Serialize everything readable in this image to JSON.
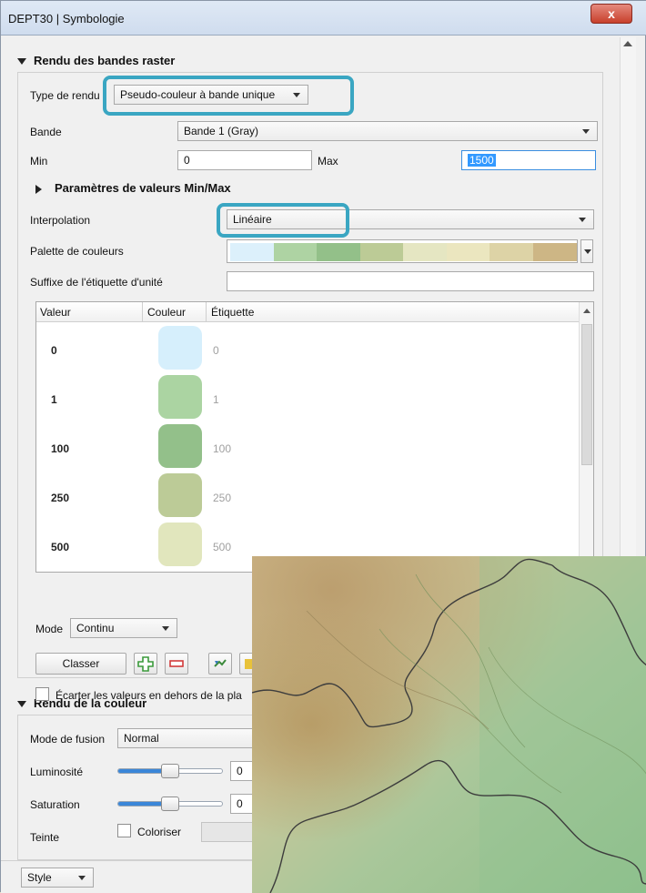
{
  "window": {
    "title": "DEPT30 | Symbologie",
    "close_label": "x"
  },
  "band_rendering": {
    "header": "Rendu des bandes raster",
    "render_type_label": "Type de rendu",
    "render_type_value": "Pseudo-couleur à bande unique",
    "band_label": "Bande",
    "band_value": "Bande 1 (Gray)",
    "min_label": "Min",
    "min_value": "0",
    "max_label": "Max",
    "max_value": "1500",
    "minmax_params_header": "Paramètres de valeurs Min/Max",
    "interpolation_label": "Interpolation",
    "interpolation_value": "Linéaire",
    "palette_label": "Palette de couleurs",
    "palette_colors": [
      "#dcf0fb",
      "#aed3a3",
      "#93c089",
      "#bccb96",
      "#e5e6c2",
      "#ebe6bf",
      "#ddd3a6",
      "#cdb685"
    ],
    "unit_suffix_label": "Suffixe de l'étiquette d'unité",
    "unit_suffix_value": ""
  },
  "table": {
    "col_value": "Valeur",
    "col_color": "Couleur",
    "col_label": "Étiquette",
    "rows": [
      {
        "value": "0",
        "color": "#d6effc",
        "label": "0"
      },
      {
        "value": "1",
        "color": "#abd4a2",
        "label": "1"
      },
      {
        "value": "100",
        "color": "#93c08a",
        "label": "100"
      },
      {
        "value": "250",
        "color": "#bccb97",
        "label": "250"
      },
      {
        "value": "500",
        "color": "#e1e6bd",
        "label": "500"
      }
    ]
  },
  "mode": {
    "label": "Mode",
    "value": "Continu",
    "classify_button": "Classer"
  },
  "discard_checkbox_label": "Écarter les valeurs en dehors de la pla",
  "color_rendering": {
    "header": "Rendu de la couleur",
    "blend_label": "Mode de fusion",
    "blend_value": "Normal",
    "brightness_label": "Luminosité",
    "brightness_value": "0",
    "brightness_level": 0.5,
    "saturation_label": "Saturation",
    "saturation_value": "0",
    "saturation_level": 0.5,
    "hue_label": "Teinte",
    "colorize_label": "Coloriser"
  },
  "style_button": "Style",
  "accent_colors": {
    "highlight": "#3aa6c2",
    "slider_fill": "#3a86d8",
    "close_button": "#c8402c"
  }
}
